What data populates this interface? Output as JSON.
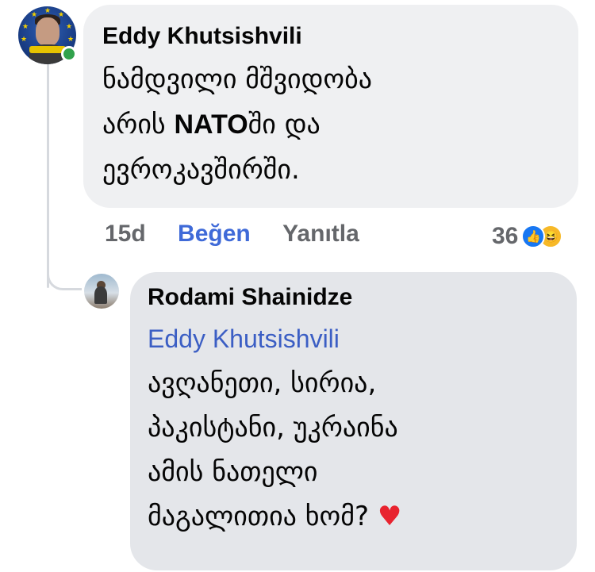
{
  "comment": {
    "author": "Eddy Khutsishvili",
    "text_lines": [
      "ნამდვილი მშვიდობა",
      "არის ",
      "ევროკავშირში."
    ],
    "text_bold": "NATO",
    "text_after_bold": "ში და",
    "time": "15d",
    "like_label": "Beğen",
    "reply_label": "Yanıtla",
    "reaction_count": "36",
    "reactions": [
      "like-icon",
      "haha-icon"
    ],
    "online": true
  },
  "reply": {
    "author": "Rodami Shainidze",
    "mention": "Eddy Khutsishvili",
    "text_lines": [
      "ავღანეთი, სირია,",
      "პაკისტანი, უკრაინა",
      "ამის ნათელი",
      "მაგალითია ხომ?"
    ],
    "emoji": "heart-icon"
  },
  "colors": {
    "bubble_main": "#eff0f2",
    "bubble_reply": "#e4e6ea",
    "link": "#3b5ec4",
    "action_text": "#65676b",
    "online": "#31a24c",
    "heart": "#e8232f"
  }
}
